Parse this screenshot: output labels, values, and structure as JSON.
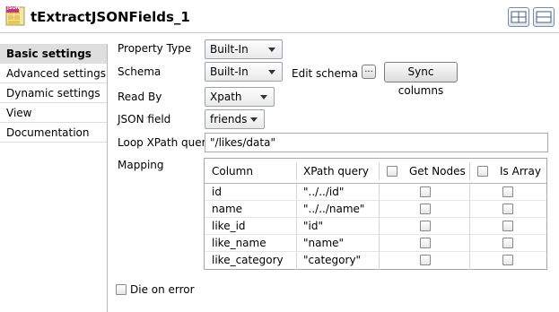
{
  "component": {
    "title": "tExtractJSONFields_1",
    "icon_name": "json-component-icon",
    "icon_label": "JSON"
  },
  "toolbar": {
    "icons": [
      "layout-split-view-icon",
      "layout-stacked-view-icon"
    ]
  },
  "sidebar": {
    "items": [
      {
        "label": "Basic settings",
        "active": true
      },
      {
        "label": "Advanced settings",
        "active": false
      },
      {
        "label": "Dynamic settings",
        "active": false
      },
      {
        "label": "View",
        "active": false
      },
      {
        "label": "Documentation",
        "active": false
      }
    ]
  },
  "form": {
    "property_type": {
      "label": "Property Type",
      "value": "Built-In"
    },
    "schema": {
      "label": "Schema",
      "value": "Built-In",
      "edit_label": "Edit schema",
      "edit_button": "...",
      "sync_button": "Sync columns"
    },
    "read_by": {
      "label": "Read By",
      "value": "Xpath"
    },
    "json_field": {
      "label": "JSON field",
      "value": "friends"
    },
    "loop_xpath": {
      "label": "Loop XPath query",
      "value": "\"/likes/data\""
    },
    "mapping": {
      "label": "Mapping",
      "headers": {
        "column": "Column",
        "xpath": "XPath query",
        "get_nodes": "Get Nodes",
        "is_array": "Is Array"
      },
      "rows": [
        {
          "column": "id",
          "xpath": "\"../../id\"",
          "get_nodes": false,
          "is_array": false
        },
        {
          "column": "name",
          "xpath": "\"../../name\"",
          "get_nodes": false,
          "is_array": false
        },
        {
          "column": "like_id",
          "xpath": "\"id\"",
          "get_nodes": false,
          "is_array": false
        },
        {
          "column": "like_name",
          "xpath": "\"name\"",
          "get_nodes": false,
          "is_array": false
        },
        {
          "column": "like_category",
          "xpath": "\"category\"",
          "get_nodes": false,
          "is_array": false
        }
      ]
    },
    "die_on_error": {
      "label": "Die on error",
      "checked": false
    }
  }
}
